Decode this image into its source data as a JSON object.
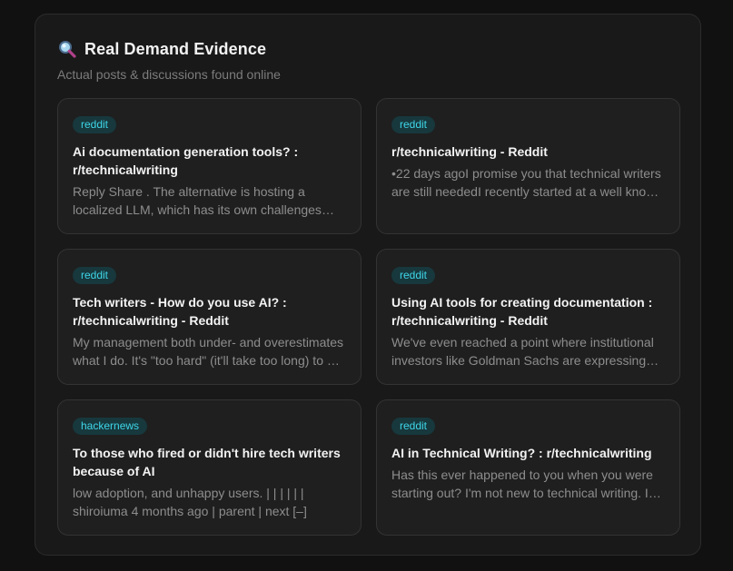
{
  "section": {
    "icon": "magnifying-glass-icon",
    "title": "Real Demand Evidence",
    "subtitle": "Actual posts & discussions found online"
  },
  "colors": {
    "badge_text": "#3ed6e8",
    "badge_bg": "#17383d"
  },
  "cards": [
    {
      "source": "reddit",
      "title": "Ai documentation generation tools? : r/technicalwriting",
      "snippet": "Reply Share . The alternative is hosting a localized LLM, which has its own challenges and costs."
    },
    {
      "source": "reddit",
      "title": "r/technicalwriting - Reddit",
      "snippet": "•22 days agoI promise you that technical writers are still neededI recently started at a well known company."
    },
    {
      "source": "reddit",
      "title": "Tech writers - How do you use AI? : r/technicalwriting - Reddit",
      "snippet": "My management both under- and overestimates what I do. It's \"too hard\" (it'll take too long) to do things."
    },
    {
      "source": "reddit",
      "title": "Using AI tools for creating documentation : r/technicalwriting - Reddit",
      "snippet": "We've even reached a point where institutional investors like Goldman Sachs are expressing doubts."
    },
    {
      "source": "hackernews",
      "title": "To those who fired or didn't hire tech writers because of AI",
      "snippet": "low adoption, and unhappy users. | | | | | | shiroiuma 4 months ago | parent | next [–]"
    },
    {
      "source": "reddit",
      "title": "AI in Technical Writing? : r/technicalwriting",
      "snippet": "Has this ever happened to you when you were starting out? I'm not new to technical writing. I have been working."
    }
  ]
}
